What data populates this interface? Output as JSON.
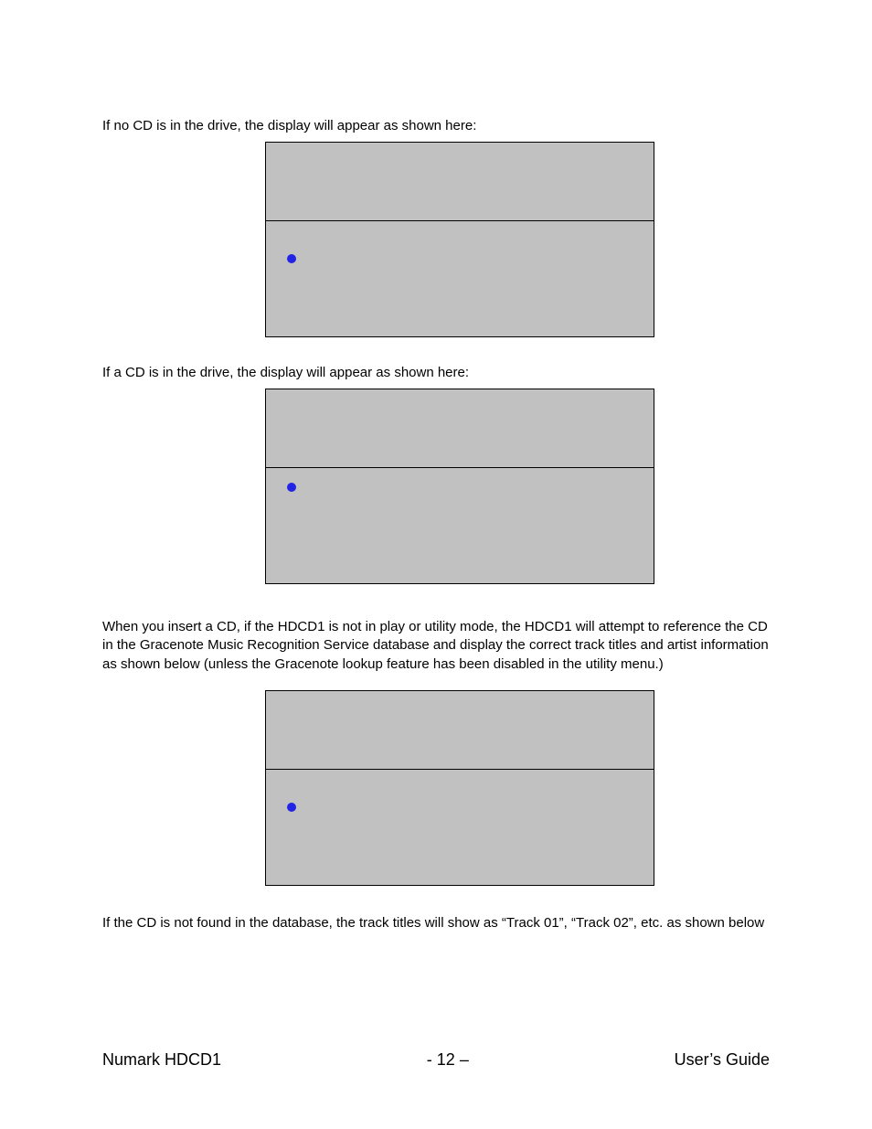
{
  "paragraphs": {
    "p1": "If no CD is in the drive, the display will appear as shown here:",
    "p2": "If a CD is in the drive, the display will appear as shown here:",
    "p3": "When you insert a CD, if the HDCD1 is not in play or utility mode, the HDCD1 will attempt to reference the CD in the Gracenote Music Recognition Service database and display the correct track titles and artist information as shown below (unless the Gracenote lookup feature has been disabled in the utility menu.)",
    "p4": "If the CD is not found in the database, the track titles will show as “Track 01”, “Track 02”, etc. as shown below"
  },
  "footer": {
    "left": "Numark HDCD1",
    "center": "- 12 –",
    "right": "User’s Guide"
  }
}
